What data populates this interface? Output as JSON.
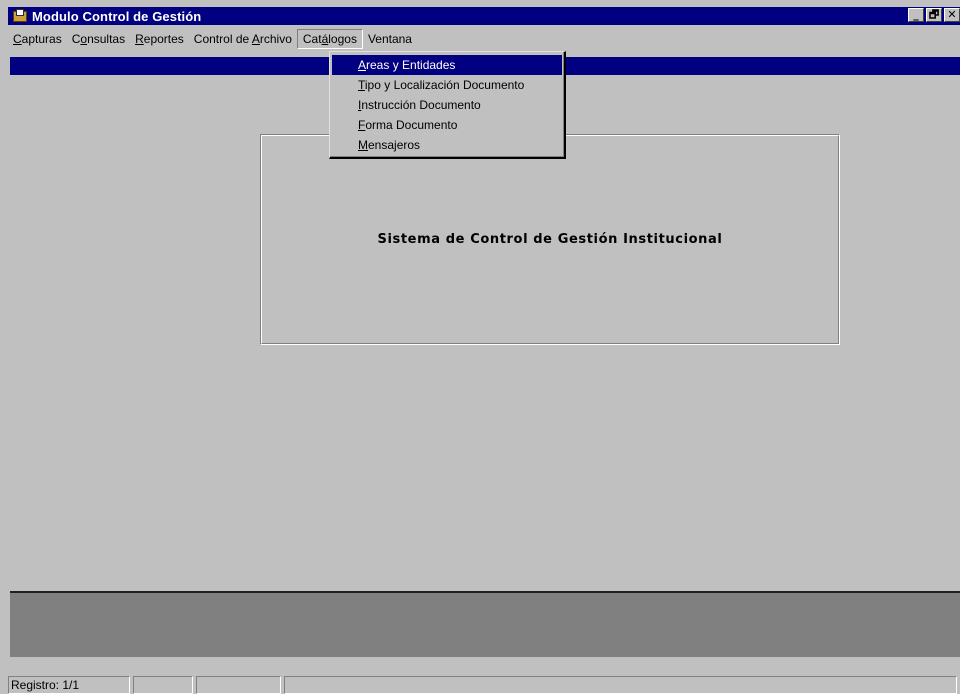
{
  "window": {
    "title": "Modulo Control de Gestión",
    "controls": {
      "minimize": "_",
      "restore": "🗗",
      "close": "✕"
    }
  },
  "menubar": {
    "items": [
      {
        "pre": "",
        "mn": "C",
        "post": "apturas"
      },
      {
        "pre": "C",
        "mn": "o",
        "post": "nsultas"
      },
      {
        "pre": "",
        "mn": "R",
        "post": "eportes"
      },
      {
        "pre": "Control de ",
        "mn": "A",
        "post": "rchivo"
      },
      {
        "pre": "Cat",
        "mn": "á",
        "post": "logos"
      },
      {
        "pre": "Ventana",
        "mn": "",
        "post": ""
      }
    ]
  },
  "dropdown": {
    "items": [
      {
        "pre": "",
        "mn": "A",
        "post": "reas y Entidades"
      },
      {
        "pre": "",
        "mn": "T",
        "post": "ipo y Localización Documento"
      },
      {
        "pre": "",
        "mn": "I",
        "post": "nstrucción Documento"
      },
      {
        "pre": "",
        "mn": "F",
        "post": "orma Documento"
      },
      {
        "pre": "",
        "mn": "M",
        "post": "ensajeros"
      }
    ]
  },
  "panel": {
    "title": "Sistema de Control de Gestión Institucional"
  },
  "statusbar": {
    "record": "Registro: 1/1",
    "cell2": "",
    "cell3": "",
    "cell4": ""
  },
  "colors": {
    "titlebar": "#000080",
    "face": "#c0c0c0",
    "selection": "#000080",
    "dark_band": "#808080"
  }
}
